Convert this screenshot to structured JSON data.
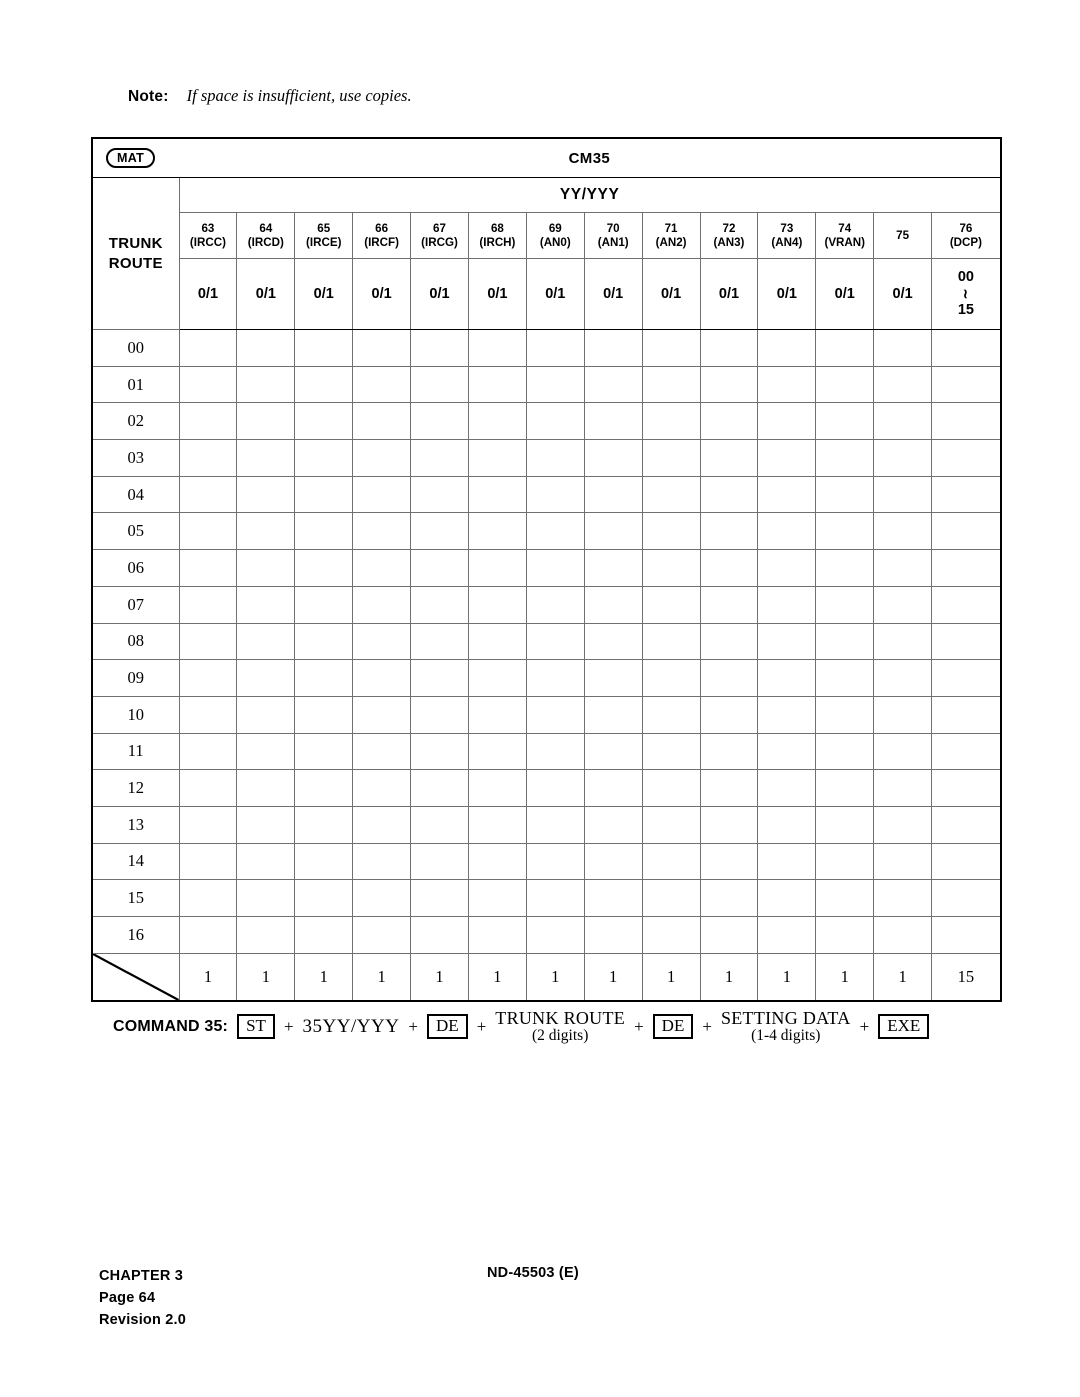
{
  "note": {
    "label": "Note:",
    "text": "If space is insufficient, use copies."
  },
  "table": {
    "badge": "MAT",
    "title": "CM35",
    "banner": "YY/YYY",
    "row_header": "TRUNK\nROUTE",
    "row_header_line1": "TRUNK",
    "row_header_line2": "ROUTE",
    "columns": [
      {
        "num": "63",
        "sub": "(IRCC)",
        "value": "0/1"
      },
      {
        "num": "64",
        "sub": "(IRCD)",
        "value": "0/1"
      },
      {
        "num": "65",
        "sub": "(IRCE)",
        "value": "0/1"
      },
      {
        "num": "66",
        "sub": "(IRCF)",
        "value": "0/1"
      },
      {
        "num": "67",
        "sub": "(IRCG)",
        "value": "0/1"
      },
      {
        "num": "68",
        "sub": "(IRCH)",
        "value": "0/1"
      },
      {
        "num": "69",
        "sub": "(AN0)",
        "value": "0/1"
      },
      {
        "num": "70",
        "sub": "(AN1)",
        "value": "0/1"
      },
      {
        "num": "71",
        "sub": "(AN2)",
        "value": "0/1"
      },
      {
        "num": "72",
        "sub": "(AN3)",
        "value": "0/1"
      },
      {
        "num": "73",
        "sub": "(AN4)",
        "value": "0/1"
      },
      {
        "num": "74",
        "sub": "(VRAN)",
        "value": "0/1"
      },
      {
        "num": "75",
        "sub": "",
        "value": "0/1"
      },
      {
        "num": "76",
        "sub": "(DCP)",
        "value_range": {
          "from": "00",
          "tilde": "≀",
          "to": "15"
        }
      }
    ],
    "rows": [
      "00",
      "01",
      "02",
      "03",
      "04",
      "05",
      "06",
      "07",
      "08",
      "09",
      "10",
      "11",
      "12",
      "13",
      "14",
      "15",
      "16"
    ],
    "totals": [
      "1",
      "1",
      "1",
      "1",
      "1",
      "1",
      "1",
      "1",
      "1",
      "1",
      "1",
      "1",
      "1",
      "15"
    ]
  },
  "command": {
    "label": "COMMAND 35:",
    "key_st": "ST",
    "plus": "+",
    "token_yy": "35YY/YYY",
    "key_de1": "DE",
    "trunk_route_top": "TRUNK ROUTE",
    "trunk_route_bot": "(2 digits)",
    "key_de2": "DE",
    "setting_data_top": "SETTING DATA",
    "setting_data_bot": "(1-4 digits)",
    "key_exe": "EXE"
  },
  "footer": {
    "chapter": "CHAPTER 3",
    "page": "Page 64",
    "revision": "Revision 2.0",
    "doc": "ND-45503 (E)"
  }
}
